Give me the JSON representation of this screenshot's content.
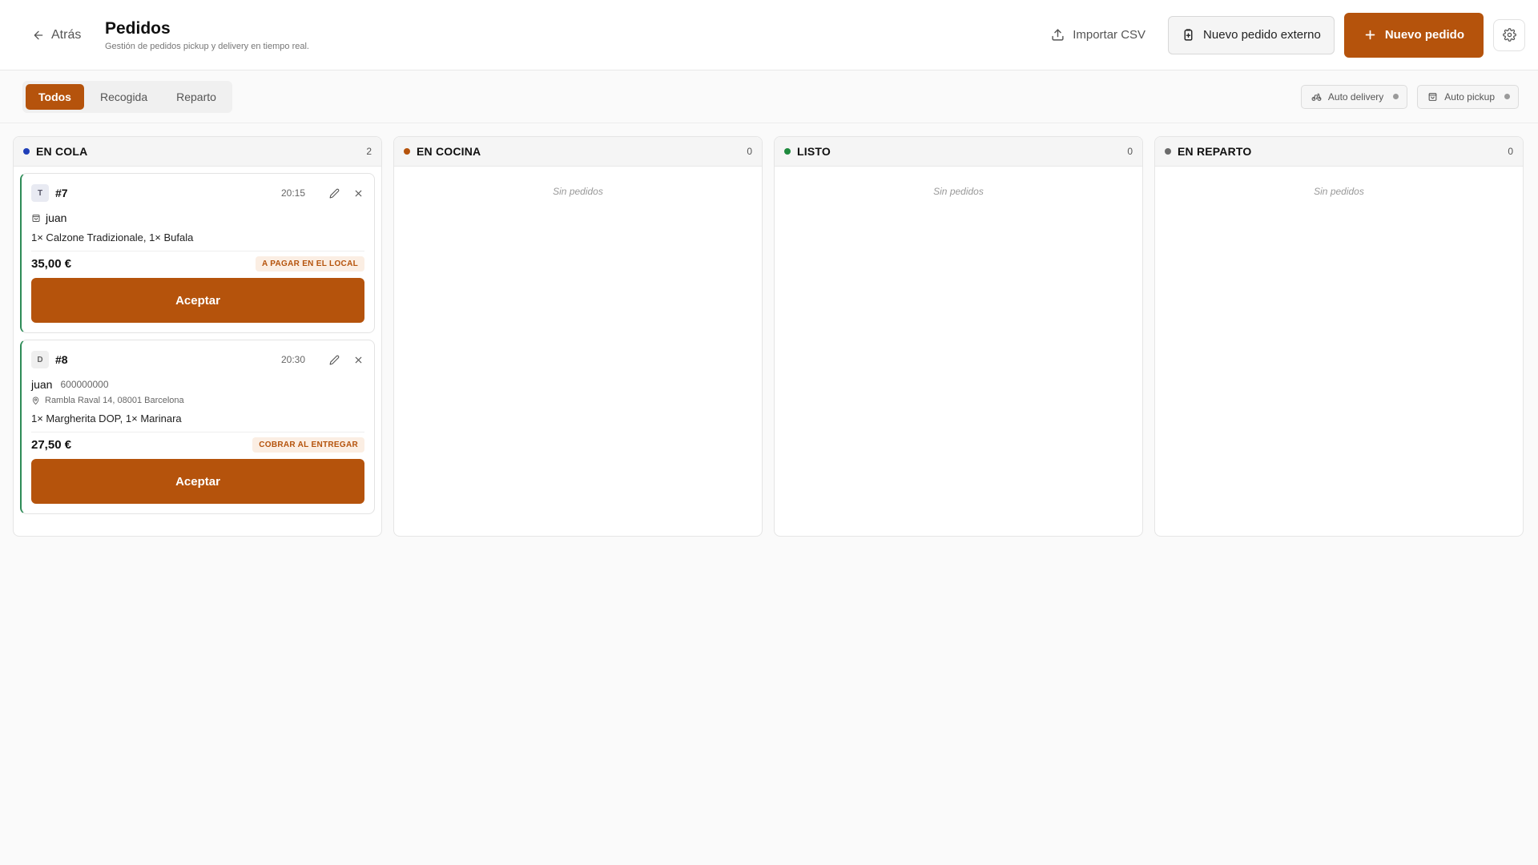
{
  "header": {
    "back_label": "Atrás",
    "title": "Pedidos",
    "subtitle": "Gestión de pedidos pickup y delivery en tiempo real.",
    "import_label": "Importar CSV",
    "external_label": "Nuevo pedido externo",
    "new_label": "Nuevo pedido"
  },
  "tabs": [
    {
      "label": "Todos",
      "active": true
    },
    {
      "label": "Recogida",
      "active": false
    },
    {
      "label": "Reparto",
      "active": false
    }
  ],
  "toggles": {
    "auto_delivery": "Auto delivery",
    "auto_pickup": "Auto pickup"
  },
  "colors": {
    "accent": "#b5530c",
    "queue": "#1f3fb8",
    "kitchen": "#b5530c",
    "ready": "#1f8a3e",
    "delivery": "#6b6b6b"
  },
  "columns": [
    {
      "title": "EN COLA",
      "count": "2"
    },
    {
      "title": "EN COCINA",
      "count": "0",
      "empty": "Sin pedidos"
    },
    {
      "title": "LISTO",
      "count": "0",
      "empty": "Sin pedidos"
    },
    {
      "title": "EN REPARTO",
      "count": "0",
      "empty": "Sin pedidos"
    }
  ],
  "orders": [
    {
      "type_letter": "T",
      "number": "#7",
      "time": "20:15",
      "customer": "juan",
      "items": "1× Calzone Tradizionale, 1× Bufala",
      "price": "35,00 €",
      "payment": "A PAGAR EN EL LOCAL",
      "action": "Aceptar"
    },
    {
      "type_letter": "D",
      "number": "#8",
      "time": "20:30",
      "customer": "juan",
      "phone": "600000000",
      "address": "Rambla Raval 14, 08001 Barcelona",
      "items": "1× Margherita DOP, 1× Marinara",
      "price": "27,50 €",
      "payment": "COBRAR AL ENTREGAR",
      "action": "Aceptar"
    }
  ]
}
